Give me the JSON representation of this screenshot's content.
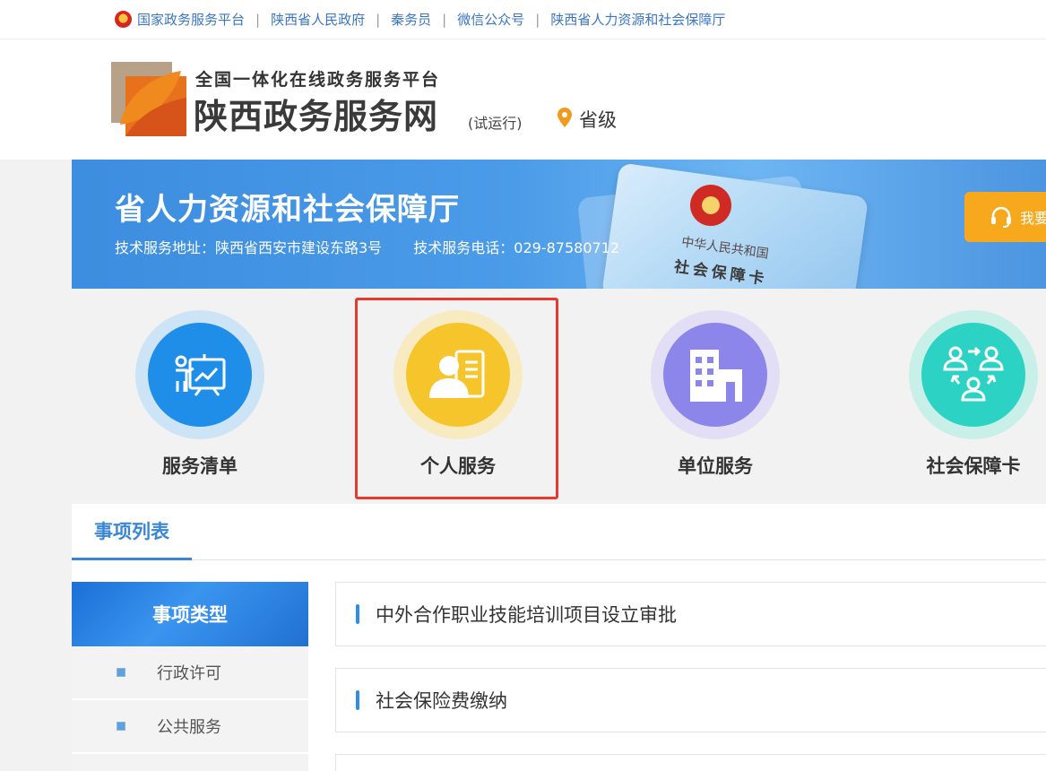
{
  "topbar": {
    "links": [
      "国家政务服务平台",
      "陕西省人民政府",
      "秦务员",
      "微信公众号",
      "陕西省人力资源和社会保障厅"
    ]
  },
  "header": {
    "brand_sub": "全国一体化在线政务服务平台",
    "brand_main": "陕西政务服务网",
    "trial": "(试运行)",
    "location": "省级"
  },
  "banner": {
    "title": "省人力资源和社会保障厅",
    "address": "技术服务地址：陕西省西安市建设东路3号",
    "phone": "技术服务电话：029-87580712",
    "card_line1": "中华人民共和国",
    "card_line2": "社会保障卡",
    "help_label": "我要"
  },
  "services": [
    {
      "label": "服务清单",
      "icon": "presentation-icon",
      "color": "#1e8ee8"
    },
    {
      "label": "个人服务",
      "icon": "person-card-icon",
      "color": "#f6c52c"
    },
    {
      "label": "单位服务",
      "icon": "building-icon",
      "color": "#8d86ea"
    },
    {
      "label": "社会保障卡",
      "icon": "people-exchange-icon",
      "color": "#2cd3c4"
    }
  ],
  "tabs": {
    "active": "事项列表"
  },
  "sidebar": {
    "header": "事项类型",
    "items": [
      "行政许可",
      "公共服务"
    ]
  },
  "items": [
    "中外合作职业技能培训项目设立审批",
    "社会保险费缴纳"
  ]
}
